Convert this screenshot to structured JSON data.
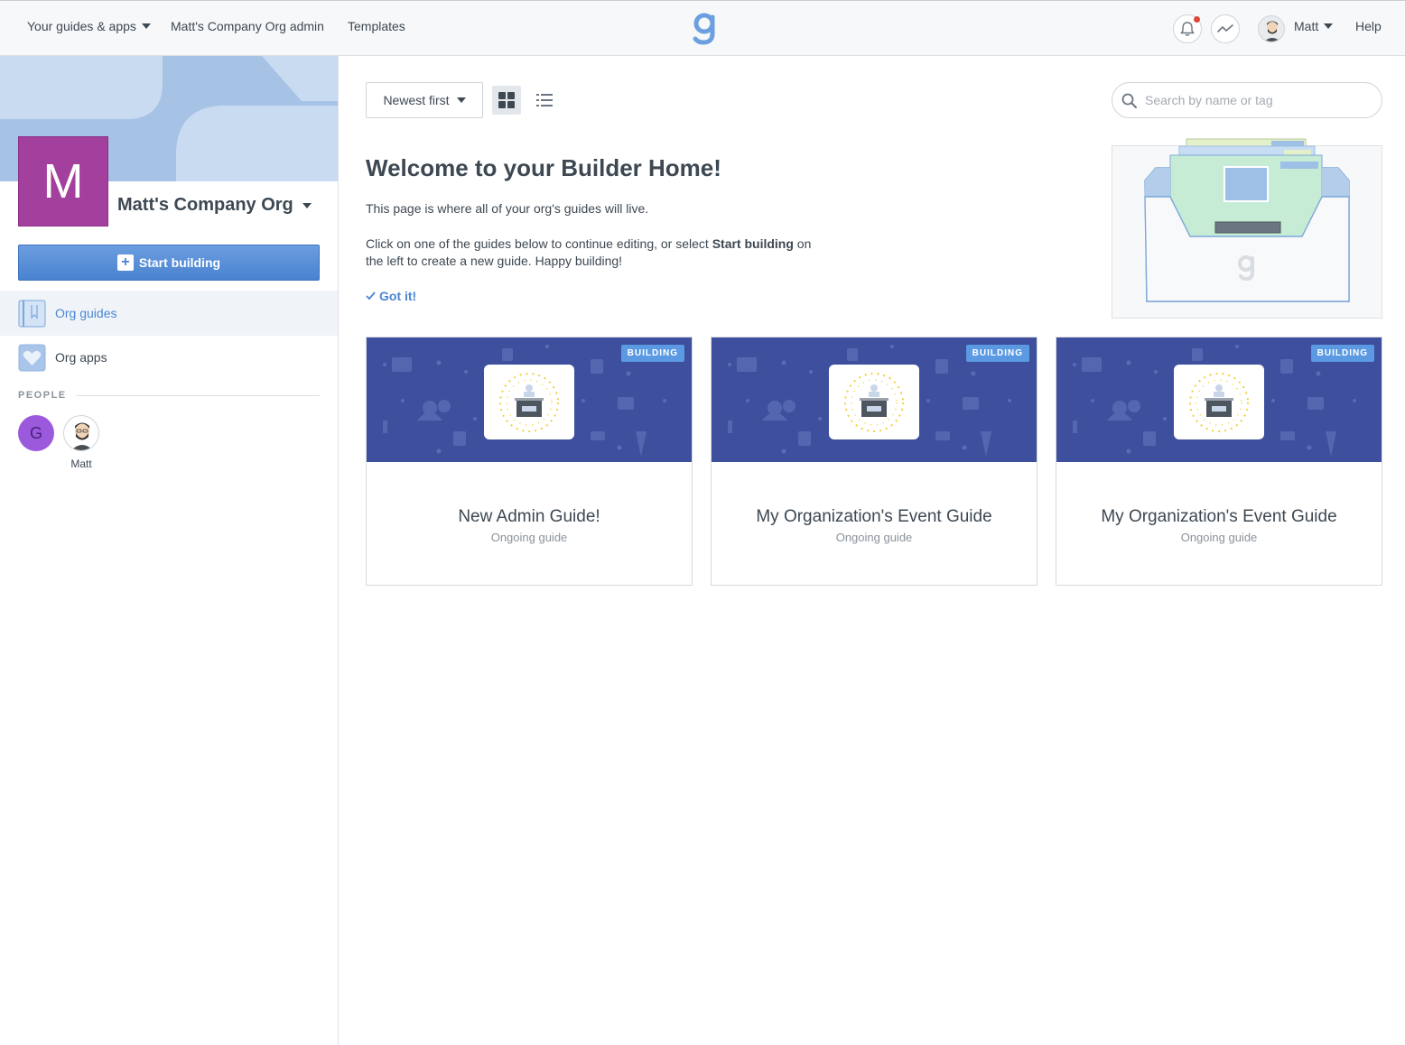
{
  "nav": {
    "guides_apps": "Your guides & apps",
    "org_admin": "Matt's Company Org admin",
    "templates": "Templates",
    "user_name": "Matt",
    "help": "Help",
    "icons": [
      "bell-icon",
      "activity-icon"
    ]
  },
  "sidebar": {
    "org_initial": "M",
    "org_name": "Matt's Company Org",
    "start_building": "Start building",
    "items": [
      {
        "label": "Org guides",
        "icon": "guide-book-icon",
        "active": true
      },
      {
        "label": "Org apps",
        "icon": "heart-icon",
        "active": false
      }
    ],
    "people_label": "PEOPLE",
    "people": [
      {
        "initial": "G",
        "name": ""
      },
      {
        "initial": "",
        "name": "Matt"
      }
    ]
  },
  "toolbar": {
    "sort_label": "Newest first",
    "search_placeholder": "Search by name or tag"
  },
  "welcome": {
    "title": "Welcome to your Builder Home!",
    "line1": "This page is where all of your org's guides will live.",
    "line2_before": "Click on one of the guides below to continue editing, or select ",
    "line2_bold": "Start building",
    "line2_after": " on the left to create a new guide. Happy building!",
    "got_it": "Got it!"
  },
  "guides": [
    {
      "title": "New Admin Guide!",
      "subtitle": "Ongoing guide",
      "badge": "BUILDING"
    },
    {
      "title": "My Organization's Event Guide",
      "subtitle": "Ongoing guide",
      "badge": "BUILDING"
    },
    {
      "title": "My Organization's Event Guide",
      "subtitle": "Ongoing guide",
      "badge": "BUILDING"
    }
  ],
  "colors": {
    "accent": "#4a86d4",
    "org_avatar": "#a33f9c",
    "card_banner": "#3e4f9e",
    "badge": "#5b9ae3"
  }
}
